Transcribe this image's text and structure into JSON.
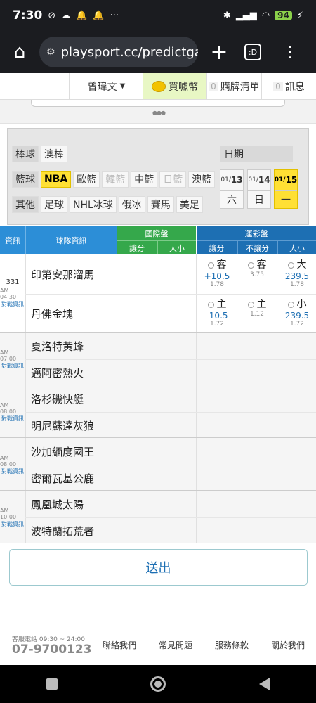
{
  "status": {
    "time": "7:30",
    "battery": "94"
  },
  "browser": {
    "url": "playsport.cc/predictga",
    "tabs_label": ":D"
  },
  "nav": {
    "user": "曾瑋文",
    "buy": "買噱幣",
    "cart_count": "0",
    "cart": "購牌清單",
    "msg_count": "0",
    "msg": "訊息"
  },
  "filter": {
    "rows": [
      {
        "cat": "棒球",
        "items": [
          {
            "label": "澳棒",
            "state": "normal"
          }
        ]
      },
      {
        "cat": "籃球",
        "items": [
          {
            "label": "NBA",
            "state": "selected"
          },
          {
            "label": "歐籃",
            "state": "normal"
          },
          {
            "label": "韓籃",
            "state": "disabled"
          },
          {
            "label": "中籃",
            "state": "normal"
          },
          {
            "label": "日籃",
            "state": "disabled"
          },
          {
            "label": "澳籃",
            "state": "normal"
          }
        ]
      },
      {
        "cat": "其他",
        "items": [
          {
            "label": "足球",
            "state": "normal"
          },
          {
            "label": "NHL冰球",
            "state": "normal"
          },
          {
            "label": "俄冰",
            "state": "normal"
          },
          {
            "label": "賽馬",
            "state": "normal"
          },
          {
            "label": "美足",
            "state": "normal"
          }
        ]
      }
    ],
    "date_label": "日期",
    "dates": [
      {
        "month": "01/",
        "day": "13",
        "weekday": "六",
        "selected": false
      },
      {
        "month": "01/",
        "day": "14",
        "weekday": "日",
        "selected": false
      },
      {
        "month": "01/",
        "day": "15",
        "weekday": "一",
        "selected": true
      }
    ]
  },
  "table": {
    "h_info": "資訊",
    "h_team": "球隊資訊",
    "h_intl": "國際盤",
    "h_lottery": "運彩盤",
    "h_spread": "讓分",
    "h_total": "大小",
    "h_spread2": "讓分",
    "h_nospread": "不讓分",
    "h_total2": "大小",
    "games": [
      {
        "num": "331",
        "time": "AM 04:30",
        "link": "對戰資訊",
        "away": "印第安那溜馬",
        "home": "丹佛金塊",
        "odds": {
          "away_spread": {
            "label": "客",
            "value": "+10.5",
            "odd": "1.78"
          },
          "away_ml": {
            "label": "客",
            "value": "",
            "odd": "3.75"
          },
          "over": {
            "label": "大",
            "value": "239.5",
            "odd": "1.78"
          },
          "home_spread": {
            "label": "主",
            "value": "-10.5",
            "odd": "1.72"
          },
          "home_ml": {
            "label": "主",
            "value": "",
            "odd": "1.12"
          },
          "under": {
            "label": "小",
            "value": "239.5",
            "odd": "1.72"
          }
        }
      },
      {
        "num": "",
        "time": "AM 07:00",
        "link": "對戰資訊",
        "away": "夏洛特黃蜂",
        "home": "邁阿密熱火"
      },
      {
        "num": "",
        "time": "AM 08:00",
        "link": "對戰資訊",
        "away": "洛杉磯快艇",
        "home": "明尼蘇達灰狼"
      },
      {
        "num": "",
        "time": "AM 08:00",
        "link": "對戰資訊",
        "away": "沙加緬度國王",
        "home": "密爾瓦基公鹿"
      },
      {
        "num": "",
        "time": "AM 10:00",
        "link": "對戰資訊",
        "away": "鳳凰城太陽",
        "home": "波特蘭拓荒者"
      }
    ]
  },
  "submit": "送出",
  "footer": {
    "hours": "客服電話 09:30 ~ 24:00",
    "phone": "07-9700123",
    "links": [
      "聯絡我們",
      "常見問題",
      "服務條款",
      "關於我們"
    ]
  }
}
